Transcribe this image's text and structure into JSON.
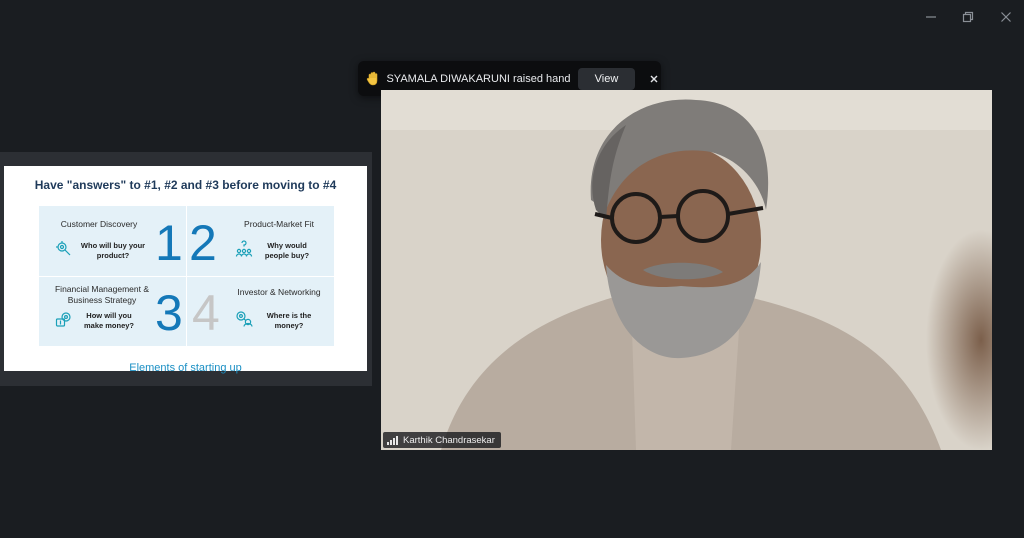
{
  "window": {
    "controls": [
      "minimize-icon",
      "restore-icon",
      "close-icon"
    ]
  },
  "toast": {
    "icon": "raised-hand-icon",
    "message": "SYAMALA DIWAKARUNI raised hand",
    "view_label": "View",
    "close_icon": "close-icon"
  },
  "slide": {
    "title": "Have \"answers\" to #1, #2 and #3 before moving to #4",
    "cells": [
      {
        "title": "Customer Discovery",
        "question": "Who will buy your product?",
        "icon": "gear-search-icon",
        "number": "1"
      },
      {
        "title": "Product-Market Fit",
        "question": "Why would people buy?",
        "icon": "people-question-icon",
        "number": "2"
      },
      {
        "title": "Financial Management & Business Strategy",
        "question": "How will you make money?",
        "icon": "money-gear-icon",
        "number": "3"
      },
      {
        "title": "Investor & Networking",
        "question": "Where is the money?",
        "icon": "investor-network-icon",
        "number": "4"
      }
    ],
    "caption": "Elements of starting up",
    "colors": {
      "number_blue": "#1478b8",
      "number_grey": "#c6c6c6",
      "title": "#1f3a5a"
    }
  },
  "video": {
    "participant_name": "Karthik Chandrasekar",
    "signal_icon": "signal-bars-icon"
  }
}
